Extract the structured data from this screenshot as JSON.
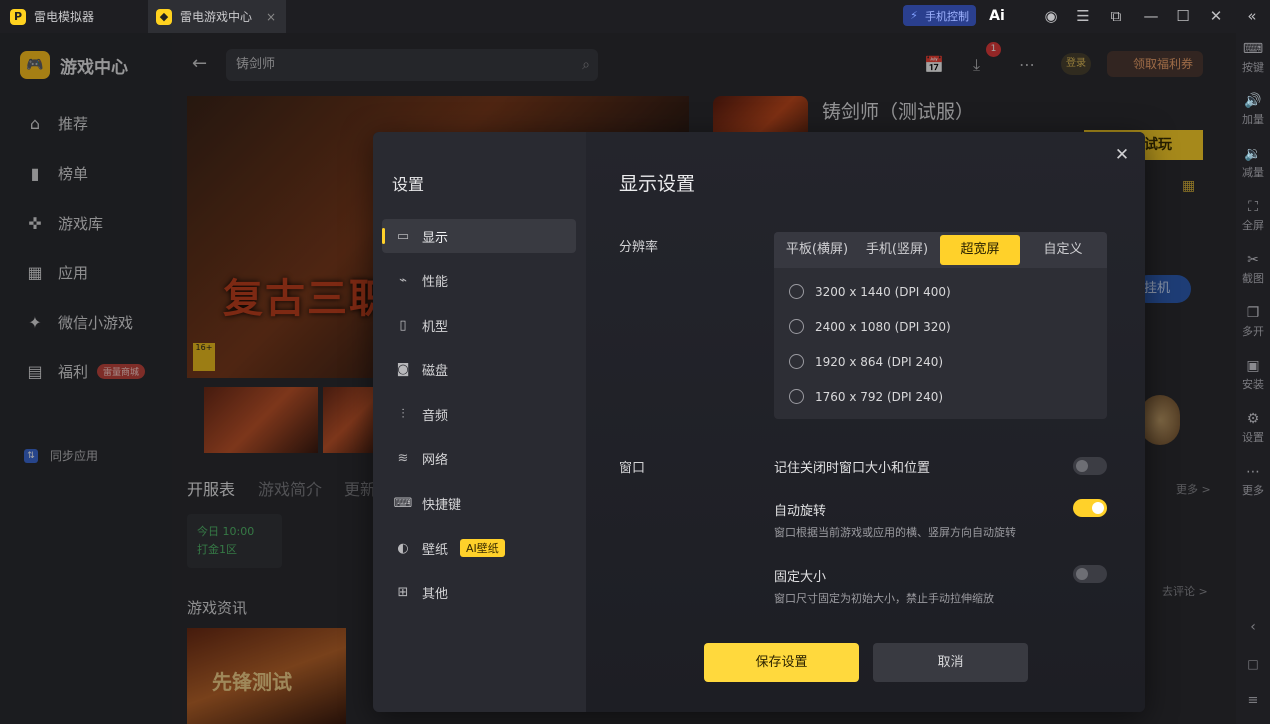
{
  "titlebar": {
    "tabs": [
      {
        "label": "雷电模拟器",
        "logo": "P"
      },
      {
        "label": "雷电游戏中心",
        "logo": "◆"
      }
    ],
    "phone_control": "手机控制",
    "ai_label": "Ai",
    "close_glyph": "×"
  },
  "rightbar": {
    "items": [
      "按键",
      "加量",
      "减量",
      "全屏",
      "截图",
      "多开",
      "安装",
      "设置",
      "更多"
    ]
  },
  "sidebar": {
    "brand": "游戏中心",
    "nav": [
      {
        "label": "推荐",
        "icon": "home-icon"
      },
      {
        "label": "榜单",
        "icon": "chart-icon"
      },
      {
        "label": "游戏库",
        "icon": "gamepad-icon"
      },
      {
        "label": "应用",
        "icon": "apps-icon"
      },
      {
        "label": "微信小游戏",
        "icon": "mini-game-icon"
      },
      {
        "label": "福利",
        "icon": "gift-icon"
      }
    ],
    "mall_badge": "雷量商城",
    "sync": "同步应用"
  },
  "header": {
    "search_value": "铸剑师",
    "download_badge": "1",
    "login": "登录",
    "welfare": "领取福利券"
  },
  "game": {
    "title": "铸剑师（测试服）",
    "try_label": "试玩",
    "hang_label": "挂机",
    "banner_text": "复古三职",
    "age": "16+",
    "page_tabs": [
      "开服表",
      "游戏简介",
      "更新"
    ],
    "open_time": "今日 10:00",
    "open_server": "打金1区",
    "news_title": "游戏资讯",
    "news_caption": "先锋测试",
    "more": "更多 >",
    "comment": "去评论 >"
  },
  "dialog": {
    "title": "设置",
    "menu": [
      {
        "label": "显示",
        "icon": "monitor-icon",
        "active": true
      },
      {
        "label": "性能",
        "icon": "performance-icon"
      },
      {
        "label": "机型",
        "icon": "phone-icon"
      },
      {
        "label": "磁盘",
        "icon": "disk-icon"
      },
      {
        "label": "音频",
        "icon": "audio-icon"
      },
      {
        "label": "网络",
        "icon": "wifi-icon"
      },
      {
        "label": "快捷键",
        "icon": "keyboard-icon"
      },
      {
        "label": "壁纸",
        "icon": "palette-icon",
        "badge": "AI壁纸"
      },
      {
        "label": "其他",
        "icon": "grid-icon"
      }
    ],
    "section_title": "显示设置",
    "resolution_label": "分辨率",
    "res_tabs": [
      "平板(横屏)",
      "手机(竖屏)",
      "超宽屏",
      "自定义"
    ],
    "res_tab_active": "超宽屏",
    "res_options": [
      "3200 x 1440  (DPI 400)",
      "2400 x 1080  (DPI 320)",
      "1920 x 864  (DPI 240)",
      "1760 x 792  (DPI 240)"
    ],
    "window_label": "窗口",
    "window_opts": [
      {
        "title": "记住关闭时窗口大小和位置",
        "sub": "",
        "on": false
      },
      {
        "title": "自动旋转",
        "sub": "窗口根据当前游戏或应用的横、竖屏方向自动旋转",
        "on": true
      },
      {
        "title": "固定大小",
        "sub": "窗口尺寸固定为初始大小，禁止手动拉伸缩放",
        "on": false
      }
    ],
    "save_label": "保存设置",
    "cancel_label": "取消"
  },
  "colors": {
    "accent": "#ffd12a",
    "dialog_bg": "#1c1d23",
    "sidebar_bg": "#292a31"
  }
}
